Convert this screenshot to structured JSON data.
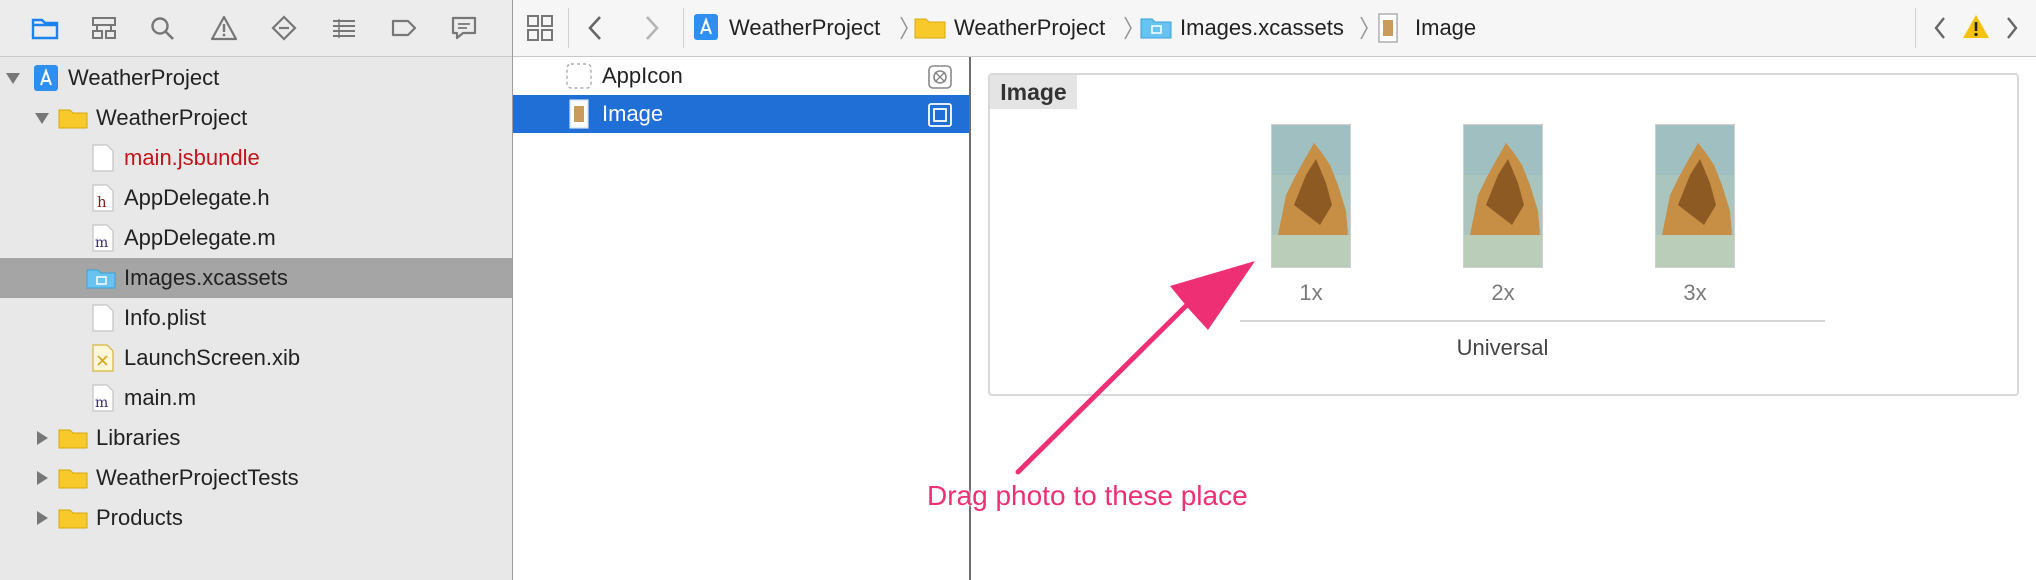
{
  "navigator": {
    "toolbar_icons": [
      "folder-icon",
      "hierarchy-icon",
      "search-icon",
      "warning-icon",
      "breakpoint-diamond-icon",
      "list-icon",
      "tag-icon",
      "chat-bubble-icon"
    ],
    "tree": [
      {
        "label": "WeatherProject",
        "icon": "xcode-project-icon",
        "disclosure": "expanded"
      },
      {
        "label": "WeatherProject",
        "icon": "yellow-folder-icon",
        "disclosure": "expanded"
      },
      {
        "label": "main.jsbundle",
        "icon": "file-icon",
        "color": "#c2141b"
      },
      {
        "label": "AppDelegate.h",
        "icon": "h-file-icon"
      },
      {
        "label": "AppDelegate.m",
        "icon": "m-file-icon"
      },
      {
        "label": "Images.xcassets",
        "icon": "asset-catalog-folder-icon",
        "selected": true
      },
      {
        "label": "Info.plist",
        "icon": "file-icon"
      },
      {
        "label": "LaunchScreen.xib",
        "icon": "xib-file-icon"
      },
      {
        "label": "main.m",
        "icon": "m-file-icon"
      },
      {
        "label": "Libraries",
        "icon": "yellow-folder-icon",
        "disclosure": "collapsed"
      },
      {
        "label": "WeatherProjectTests",
        "icon": "yellow-folder-icon",
        "disclosure": "collapsed"
      },
      {
        "label": "Products",
        "icon": "yellow-folder-icon",
        "disclosure": "collapsed"
      }
    ]
  },
  "jumpbar": {
    "crumbs": [
      "WeatherProject",
      "WeatherProject",
      "Images.xcassets",
      "Image"
    ]
  },
  "asset_list": {
    "items": [
      {
        "label": "AppIcon",
        "selected": false
      },
      {
        "label": "Image",
        "selected": true
      }
    ]
  },
  "detail": {
    "set_title": "Image",
    "slots": [
      "1x",
      "2x",
      "3x"
    ],
    "group_label": "Universal"
  },
  "annotation": {
    "text": "Drag photo to these place",
    "color": "#ee2f74"
  },
  "colors": {
    "selection_blue": "#1f6fd6",
    "navigator_selection": "#a5a5a5",
    "warning_yellow": "#f4c20d"
  }
}
